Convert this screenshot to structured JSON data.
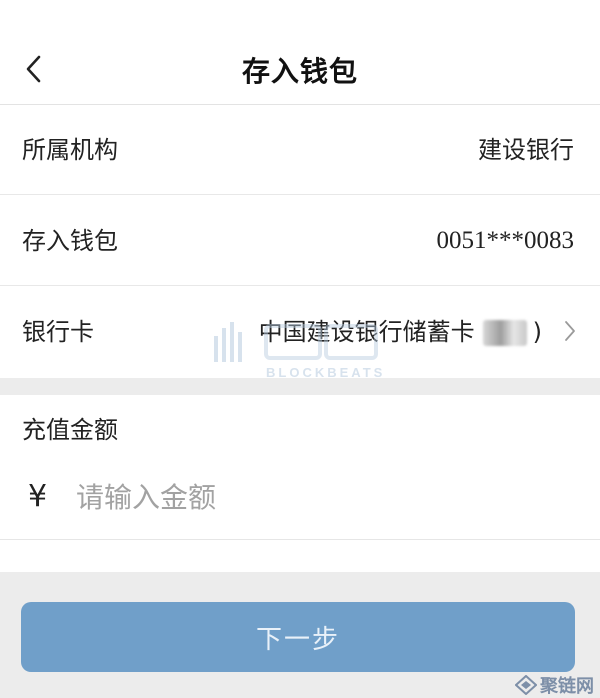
{
  "header": {
    "title": "存入钱包"
  },
  "rows": [
    {
      "label": "所属机构",
      "value": "建设银行"
    },
    {
      "label": "存入钱包",
      "value": "0051***0083"
    },
    {
      "label": "银行卡",
      "value_prefix": "中国建设银行储蓄卡",
      "value_suffix": ")"
    }
  ],
  "amount": {
    "label": "充值金额",
    "currency_symbol": "¥",
    "placeholder": "请输入金额",
    "value": ""
  },
  "next_button": {
    "label": "下一步"
  },
  "watermark": {
    "text": "BLOCKBEATS"
  },
  "brand": {
    "text": "聚链网"
  },
  "colors": {
    "primary_button": "#709fc9",
    "background": "#ececec"
  }
}
